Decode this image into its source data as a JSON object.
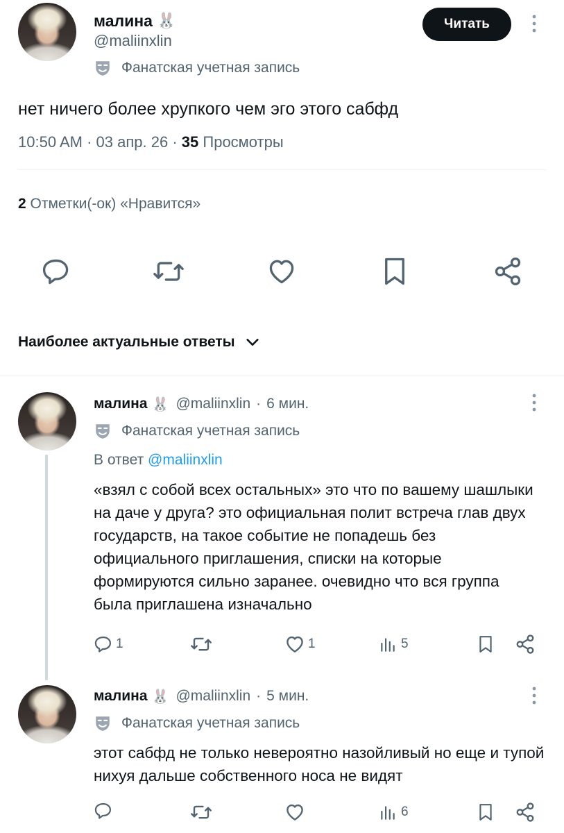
{
  "main_tweet": {
    "author_name": "малина",
    "name_emoji": "🐰",
    "handle": "@maliinxlin",
    "account_label": "Фанатская учетная запись",
    "follow_label": "Читать",
    "text": "нет ничего более хрупкого чем эго этого сабфд",
    "time": "10:50 AM",
    "date": "03 апр. 26",
    "views_count": "35",
    "views_label": "Просмотры",
    "separator": "·",
    "likes_count": "2",
    "likes_label": "Отметки(-ок) «Нравится»"
  },
  "replies_sort": {
    "label": "Наиболее актуальные ответы"
  },
  "replies": [
    {
      "author_name": "малина",
      "name_emoji": "🐰",
      "handle": "@maliinxlin",
      "time_ago": "6 мин.",
      "account_label": "Фанатская учетная запись",
      "reply_to_prefix": "В ответ",
      "reply_to_handle": "@maliinxlin",
      "text": "«взял с собой всех остальных» это что по вашему шашлыки на даче у друга? это официальная полит встреча глав двух государств, на такое событие не попадешь без официального приглашения, списки на которые формируются сильно заранее. очевидно что вся группа была приглашена изначально",
      "reply_count": "1",
      "like_count": "1",
      "view_count": "5"
    },
    {
      "author_name": "малина",
      "name_emoji": "🐰",
      "handle": "@maliinxlin",
      "time_ago": "5 мин.",
      "account_label": "Фанатская учетная запись",
      "text": "этот сабфд не только невероятно назойливый но еще и тупой нихуя дальше собственного носа не видят",
      "view_count": "6"
    }
  ],
  "colors": {
    "text": "#0f1419",
    "muted": "#536471",
    "link": "#1d9bf0",
    "button": "#0f1419",
    "divider": "#eff3f4"
  },
  "icons": [
    "more-icon",
    "mask-icon",
    "reply-icon",
    "retweet-icon",
    "like-icon",
    "bookmark-icon",
    "share-icon",
    "views-icon",
    "chevron-down-icon",
    "bunny-emoji-icon"
  ]
}
